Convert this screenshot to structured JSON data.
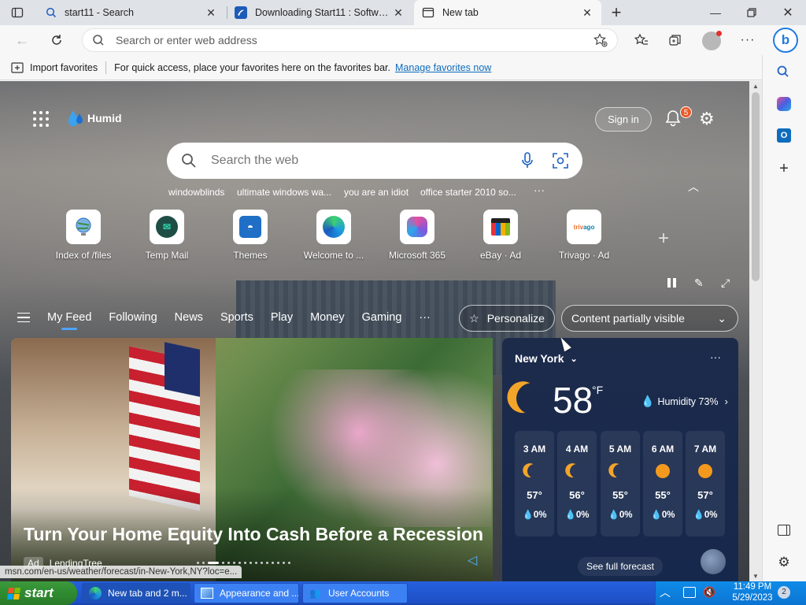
{
  "tabs": [
    {
      "label": "start11 - Search",
      "icon": "search-icon"
    },
    {
      "label": "Downloading Start11 : Software",
      "icon": "softpedia-icon"
    },
    {
      "label": "New tab",
      "icon": "newtab-icon"
    }
  ],
  "address": {
    "placeholder": "Search or enter web address"
  },
  "favbar": {
    "import_label": "Import favorites",
    "hint": "For quick access, place your favorites here on the favorites bar.",
    "manage_link": "Manage favorites now"
  },
  "newtab": {
    "weather_badge": "Humid",
    "sign_in": "Sign in",
    "notification_count": "5",
    "search_placeholder": "Search the web",
    "trending": [
      "windowblinds",
      "ultimate windows wa...",
      "you are an idiot",
      "office starter 2010 so..."
    ],
    "tiles": [
      {
        "label": "Index of /files",
        "icon": "globe-icon"
      },
      {
        "label": "Temp Mail",
        "icon": "tempmail-icon"
      },
      {
        "label": "Themes",
        "icon": "themes-icon"
      },
      {
        "label": "Welcome to ...",
        "icon": "edge-icon"
      },
      {
        "label": "Microsoft 365",
        "icon": "m365-icon"
      },
      {
        "label": "eBay · Ad",
        "icon": "ebay-icon"
      },
      {
        "label": "Trivago · Ad",
        "icon": "trivago-icon"
      }
    ],
    "feed_tabs": [
      "My Feed",
      "Following",
      "News",
      "Sports",
      "Play",
      "Money",
      "Gaming"
    ],
    "personalize": "Personalize",
    "content_visibility": "Content partially visible",
    "hero": {
      "title": "Turn Your Home Equity Into Cash Before a Recession",
      "ad_badge": "Ad",
      "source": "LendingTree"
    },
    "status_url": "msn.com/en-us/weather/forecast/in-New-York,NY?loc=e...",
    "weather": {
      "city": "New York",
      "temp": "58",
      "unit": "°F",
      "humidity": "Humidity 73%",
      "hours": [
        {
          "time": "3 AM",
          "temp": "57°",
          "precip": "0%",
          "icon": "moon-icon"
        },
        {
          "time": "4 AM",
          "temp": "56°",
          "precip": "0%",
          "icon": "moon-icon"
        },
        {
          "time": "5 AM",
          "temp": "55°",
          "precip": "0%",
          "icon": "moon-icon"
        },
        {
          "time": "6 AM",
          "temp": "55°",
          "precip": "0%",
          "icon": "sun-icon"
        },
        {
          "time": "7 AM",
          "temp": "57°",
          "precip": "0%",
          "icon": "sun-icon"
        }
      ],
      "see_full": "See full forecast"
    }
  },
  "taskbar": {
    "start": "start",
    "tasks": [
      {
        "label": "New tab and 2 m...",
        "icon": "edge-icon"
      },
      {
        "label": "Appearance and ...",
        "icon": "control-panel-icon"
      },
      {
        "label": "User Accounts",
        "icon": "users-icon"
      }
    ],
    "time": "11:49 PM",
    "date": "5/29/2023",
    "badge": "2"
  },
  "colors": {
    "accent": "#0f6cbd",
    "taskbar": "#245edb",
    "start": "#3c9a3c"
  }
}
